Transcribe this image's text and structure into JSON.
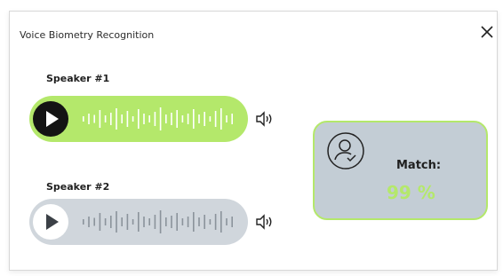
{
  "dialog": {
    "title": "Voice Biometry Recognition",
    "close_icon": "close-icon"
  },
  "speakers": [
    {
      "label": "Speaker #1",
      "state": "active",
      "pill_color": "#b4e86b",
      "play_icon": "play-icon",
      "volume_icon": "volume-icon"
    },
    {
      "label": "Speaker #2",
      "state": "inactive",
      "pill_color": "#d0d6dc",
      "play_icon": "play-icon",
      "volume_icon": "volume-icon"
    }
  ],
  "match": {
    "label": "Match:",
    "value": "99 %",
    "icon": "user-check-icon",
    "accent_color": "#b4e86b",
    "card_color": "#c3cdd5"
  }
}
